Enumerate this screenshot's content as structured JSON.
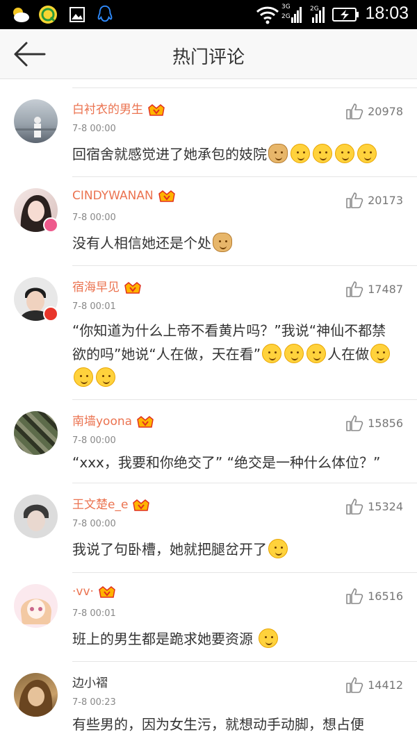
{
  "statusbar": {
    "time": "18:03",
    "net1": "3G",
    "net2": "2G",
    "net3": "2G"
  },
  "header": {
    "title": "热门评论"
  },
  "comments": [
    {
      "user": "白衬衣的男生",
      "time": "7-8 00:00",
      "likes": "20978",
      "parts": [
        "回宿舍就感觉进了她承包的妓院"
      ]
    },
    {
      "user": "CINDYWANAN",
      "time": "7-8 00:00",
      "likes": "20173",
      "parts": [
        "没有人相信她还是个处"
      ]
    },
    {
      "user": "宿海早见",
      "time": "7-8 00:01",
      "likes": "17487",
      "parts": [
        "“你知道为什么上帝不看黄片吗？”我说“神仙不都禁欲的吗”她说“人在做，天在看”",
        "人在做"
      ]
    },
    {
      "user": "南墙yoona",
      "time": "7-8 00:00",
      "likes": "15856",
      "parts": [
        "“xxx，我要和你绝交了” “绝交是一种什么体位？”"
      ]
    },
    {
      "user": "王文楚e_e",
      "time": "7-8 00:00",
      "likes": "15324",
      "parts": [
        "我说了句卧槽，她就把腿岔开了"
      ]
    },
    {
      "user": "·vv·",
      "time": "7-8 00:01",
      "likes": "16516",
      "parts": [
        "班上的男生都是跪求她要资源"
      ]
    },
    {
      "user": "边小褶",
      "time": "7-8 00:23",
      "likes": "14412",
      "parts": [
        "有些男的，因为女生污，就想动手动脚，想占便"
      ]
    }
  ]
}
